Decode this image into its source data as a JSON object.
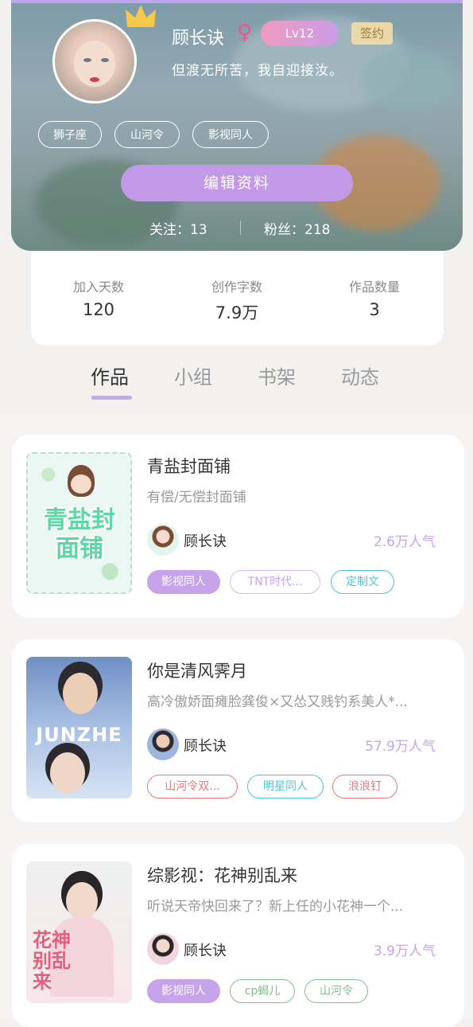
{
  "profile": {
    "username": "顾长诀",
    "gender_symbol": "♀",
    "level": "Lv12",
    "signed_badge": "签约",
    "bio": "但渡无所苦，我自迎接汝。",
    "chips": [
      "狮子座",
      "山河令",
      "影视同人"
    ],
    "edit_button": "编辑资料",
    "follow_label": "关注：13",
    "fans_label": "粉丝：218"
  },
  "stats": [
    {
      "label": "加入天数",
      "value": "120"
    },
    {
      "label": "创作字数",
      "value": "7.9万"
    },
    {
      "label": "作品数量",
      "value": "3"
    }
  ],
  "tabs": [
    "作品",
    "小组",
    "书架",
    "动态"
  ],
  "active_tab": "作品",
  "works": [
    {
      "title": "青盐封面铺",
      "desc": "有偿/无偿封面铺",
      "author": "顾长诀",
      "popularity": "2.6万人气",
      "cover_text": "青盐封面铺",
      "tags": [
        {
          "label": "影视同人",
          "style": "filled-purple"
        },
        {
          "label": "TNT时代...",
          "style": "outline-purple"
        },
        {
          "label": "定制文",
          "style": "outline-cyan"
        }
      ]
    },
    {
      "title": "你是清风霁月",
      "desc": "高冷傲娇面瘫脸龚俊×又怂又贱钓系美人*...",
      "author": "顾长诀",
      "popularity": "57.9万人气",
      "cover_text": "JUNZHE",
      "tags": [
        {
          "label": "山河令双...",
          "style": "outline-red"
        },
        {
          "label": "明星同人",
          "style": "outline-cyan"
        },
        {
          "label": "浪浪钉",
          "style": "outline-red"
        }
      ]
    },
    {
      "title": "综影视：花神别乱来",
      "desc": "听说天帝快回来了？新上任的小花神一个...",
      "author": "顾长诀",
      "popularity": "3.9万人气",
      "cover_text": "花神别乱来",
      "tags": [
        {
          "label": "影视同人",
          "style": "filled-purple"
        },
        {
          "label": "cp蝎儿",
          "style": "outline-green"
        },
        {
          "label": "山河令",
          "style": "outline-green"
        }
      ]
    }
  ],
  "colors": {
    "accent": "#c199e6",
    "popularity": "#c7a3e8",
    "tag_purple_fill": "#c7a3ec",
    "tag_cyan": "#4fc3d6",
    "tag_red": "#e37b7b",
    "tag_green": "#7fc08a"
  }
}
